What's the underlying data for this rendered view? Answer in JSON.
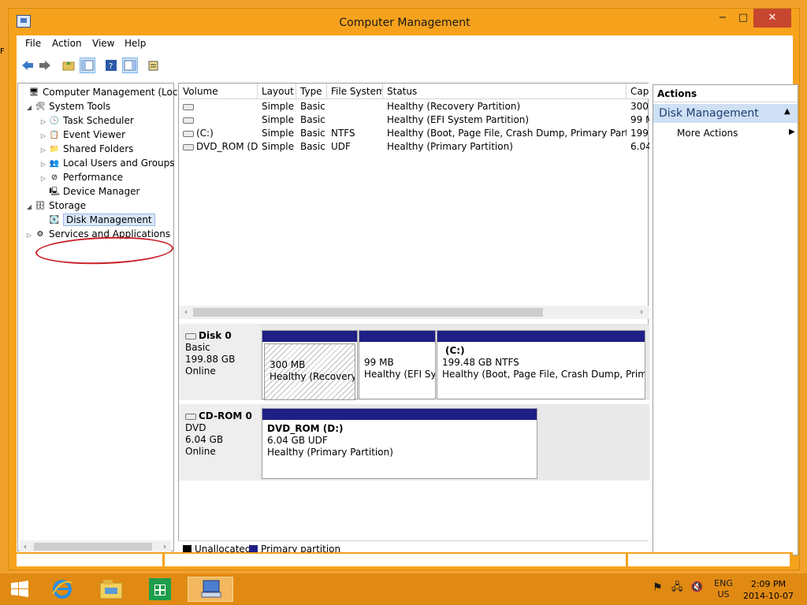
{
  "window": {
    "title": "Computer Management",
    "controls": {
      "minimize": "−",
      "maximize": "□",
      "close": "✕"
    }
  },
  "menu": {
    "items": [
      "File",
      "Action",
      "View",
      "Help"
    ]
  },
  "toolbar": {
    "icons": [
      "back-arrow-icon",
      "forward-arrow-icon",
      "up-folder-icon",
      "show-hide-tree-icon",
      "help-icon",
      "show-hide-action-pane-icon",
      "properties-icon"
    ]
  },
  "tree": {
    "root": "Computer Management (Local",
    "system_tools": "System Tools",
    "system_tools_children": [
      "Task Scheduler",
      "Event Viewer",
      "Shared Folders",
      "Local Users and Groups",
      "Performance",
      "Device Manager"
    ],
    "storage": "Storage",
    "disk_management": "Disk Management",
    "services": "Services and Applications"
  },
  "volumes": {
    "headers": [
      "Volume",
      "Layout",
      "Type",
      "File System",
      "Status",
      "Cap"
    ],
    "rows": [
      {
        "volume": "",
        "layout": "Simple",
        "type": "Basic",
        "fs": "",
        "status": "Healthy (Recovery Partition)",
        "cap": "300"
      },
      {
        "volume": "",
        "layout": "Simple",
        "type": "Basic",
        "fs": "",
        "status": "Healthy (EFI System Partition)",
        "cap": "99 M"
      },
      {
        "volume": "(C:)",
        "layout": "Simple",
        "type": "Basic",
        "fs": "NTFS",
        "status": "Healthy (Boot, Page File, Crash Dump, Primary Partition)",
        "cap": "199."
      },
      {
        "volume": "DVD_ROM (D:)",
        "layout": "Simple",
        "type": "Basic",
        "fs": "UDF",
        "status": "Healthy (Primary Partition)",
        "cap": "6.04"
      }
    ]
  },
  "disks": {
    "disk0": {
      "name": "Disk 0",
      "type": "Basic",
      "size": "199.88 GB",
      "state": "Online",
      "partitions": [
        {
          "title": "",
          "size": "300 MB",
          "status": "Healthy (Recovery P"
        },
        {
          "title": "",
          "size": "99 MB",
          "status": "Healthy (EFI Sys"
        },
        {
          "title": "(C:)",
          "size": "199.48 GB NTFS",
          "status": "Healthy (Boot, Page File, Crash Dump, Primary I"
        }
      ]
    },
    "cdrom0": {
      "name": "CD-ROM 0",
      "type": "DVD",
      "size": "6.04 GB",
      "state": "Online",
      "partition": {
        "title": "DVD_ROM  (D:)",
        "size": "6.04 GB UDF",
        "status": "Healthy (Primary Partition)"
      }
    }
  },
  "legend": {
    "unallocated": "Unallocated",
    "primary": "Primary partition"
  },
  "actions": {
    "header": "Actions",
    "selected": "Disk Management",
    "more": "More Actions"
  },
  "taskbar": {
    "lang_top": "ENG",
    "lang_bottom": "US",
    "time": "2:09 PM",
    "date": "2014-10-07"
  },
  "colors": {
    "window_frame": "#f6a21c",
    "partition_bar": "#1f1f86",
    "annotation": "#c81d25",
    "taskbar": "#e18a13"
  }
}
